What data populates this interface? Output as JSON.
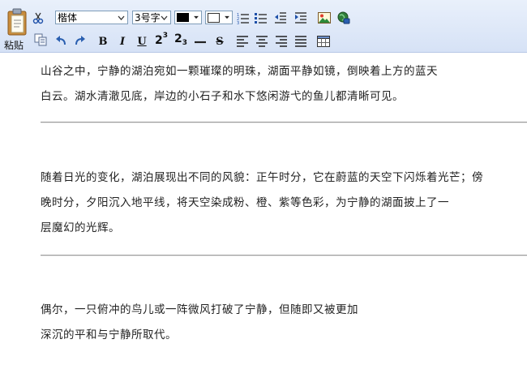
{
  "toolbar": {
    "paste_label": "粘贴",
    "font_family": "楷体",
    "font_size": "3号字",
    "bold": "B",
    "italic": "I",
    "underline": "U",
    "superscript_base": "2",
    "superscript_exp": "3",
    "subscript_base": "2",
    "subscript_exp": "3",
    "strikethrough": "S"
  },
  "content": {
    "paragraphs": [
      {
        "lines": [
          "山谷之中，宁静的湖泊宛如一颗璀璨的明珠，湖面平静如镜，倒映着上方的蓝天",
          "白云。湖水清澈见底，岸边的小石子和水下悠闲游弋的鱼儿都清晰可见。"
        ]
      },
      {
        "lines": [
          "随着日光的变化，湖泊展现出不同的风貌：正午时分，它在蔚蓝的天空下闪烁着光芒；傍",
          "晚时分，夕阳沉入地平线，将天空染成粉、橙、紫等色彩，为宁静的湖面披上了一",
          "层魔幻的光辉。"
        ]
      },
      {
        "lines": [
          "偶尔，一只俯冲的鸟儿或一阵微风打破了宁静，但随即又被更加",
          "深沉的平和与宁静所取代。"
        ]
      }
    ]
  }
}
